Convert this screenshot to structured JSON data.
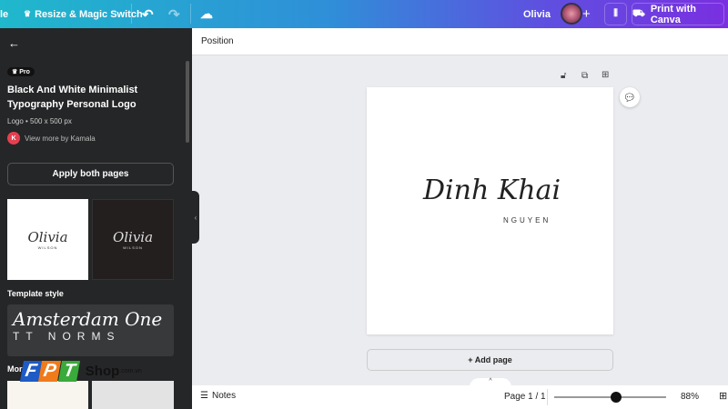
{
  "topbar": {
    "file_partial": "le",
    "resize_label": "Resize & Magic Switch",
    "user_name": "Olivia",
    "print_label": "Print with Canva"
  },
  "sidebar": {
    "pro_badge": "Pro",
    "title_line1": "Black And White Minimalist",
    "title_line2": "Typography Personal Logo",
    "meta": "Logo • 500 x 500 px",
    "author_initial": "K",
    "author_link": "View more by Kamala",
    "apply_button": "Apply both pages",
    "thumb_text": "Olivia",
    "thumb_sub": "WILSON",
    "style_heading": "Template style",
    "style_font1": "Amsterdam One",
    "style_font2": "TT NORMS",
    "more_heading": "More"
  },
  "toolbar": {
    "position_label": "Position"
  },
  "canvas": {
    "script_text": "Dinh Khai",
    "sub_text": "NGUYEN"
  },
  "add_page": "+ Add page",
  "footer": {
    "notes_label": "Notes",
    "page_indicator": "Page 1 / 1",
    "zoom_percent": "88%",
    "zoom_fraction": 0.55
  },
  "watermark": {
    "brand": "FPT",
    "shop": "Shop",
    "domain": ".com.vn"
  }
}
